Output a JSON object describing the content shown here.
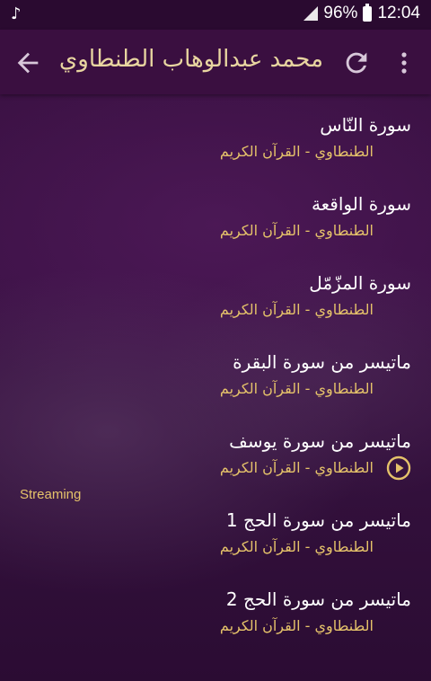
{
  "status_bar": {
    "battery": "96%",
    "time": "12:04",
    "music_icon": "music-note-icon"
  },
  "app_bar": {
    "title": "محمد عبدالوهاب الطنطاوي",
    "back_icon": "arrow-left-icon",
    "refresh_icon": "refresh-icon",
    "menu_icon": "more-vertical-icon"
  },
  "tracks": [
    {
      "title": "سورة النّاس",
      "subtitle": "الطنطاوي - القرآن الكريم"
    },
    {
      "title": "سورة الواقعة",
      "subtitle": "الطنطاوي - القرآن الكريم"
    },
    {
      "title": "سورة المزّمّل",
      "subtitle": "الطنطاوي - القرآن الكريم"
    },
    {
      "title": "ماتيسر من سورة البقرة",
      "subtitle": "الطنطاوي - القرآن الكريم"
    },
    {
      "title": "ماتيسر من سورة يوسف",
      "subtitle": "الطنطاوي - القرآن الكريم",
      "playing": true
    },
    {
      "title": "ماتيسر من سورة الحج 1",
      "subtitle": "الطنطاوي - القرآن الكريم"
    },
    {
      "title": "ماتيسر من سورة الحج 2",
      "subtitle": "الطنطاوي - القرآن الكريم"
    }
  ],
  "streaming_label": "Streaming",
  "colors": {
    "accent": "#e5c26a",
    "app_bar": "#3a0f40",
    "background": "#3a1142",
    "title_text": "#ffffff"
  }
}
